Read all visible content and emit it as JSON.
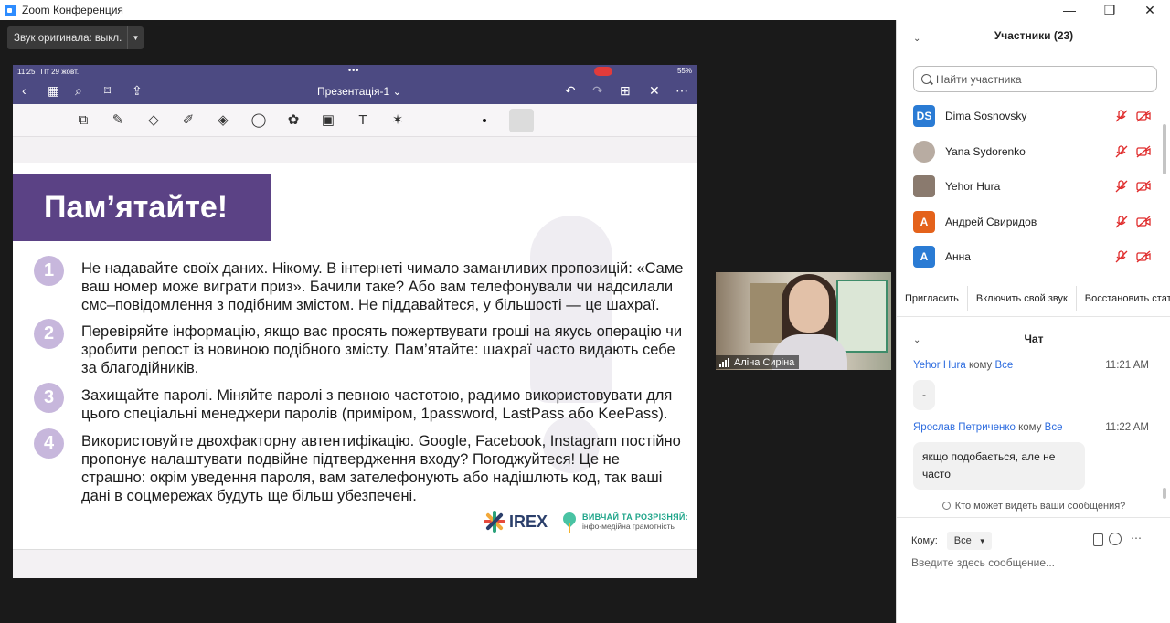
{
  "window": {
    "title": "Zoom Конференция"
  },
  "toolbar": {
    "original_sound_label": "Звук оригинала: выкл."
  },
  "shared_screen": {
    "status_time": "11:25",
    "status_date": "Пт 29 жовт.",
    "battery": "55%",
    "doc_title": "Презентація-1 ⌄",
    "slide": {
      "heading": "Пам’ятайте!",
      "items": [
        {
          "num": "1",
          "text": "Не надавайте своїх даних. Нікому. В інтернеті чимало заманливих пропозицій: «Саме ваш номер може виграти приз». Бачили таке? Або вам телефонували чи надсилали смс–повідомлення з подібним змістом. Не піддавайтеся, у більшості — це шахраї."
        },
        {
          "num": "2",
          "text": "Перевіряйте інформацію, якщо вас просять пожертвувати гроші на якусь операцію чи зробити репост із новиною подібного змісту. Пам’ятайте: шахраї часто видають себе за благодійників."
        },
        {
          "num": "3",
          "text": "Захищайте паролі. Міняйте паролі з певною частотою, радимо використовувати для цього спеціальні менеджери паролів (приміром, 1password, LastPass або KeePass)."
        },
        {
          "num": "4",
          "text": "Використовуйте двохфакторну автентифікацію. Google, Facebook, Instagram постійно пропонує налаштувати подвійне підтвердження входу? Погоджуйтеся! Це не страшно: окрім уведення пароля, вам зателефонують або надішлють код, так ваші дані в соцмережах будуть ще більш убезпечені."
        }
      ],
      "logo_irex": "IREX",
      "logo_vyv_line1": "ВИВЧАЙ ТА РОЗРІЗНЯЙ:",
      "logo_vyv_line2": "інфо-медійна грамотність"
    }
  },
  "video": {
    "participant_name": "Аліна Сиріна"
  },
  "participants": {
    "title": "Участники (23)",
    "search_placeholder": "Найти участника",
    "list": [
      {
        "initials": "DS",
        "name": "Dima Sosnovsky",
        "color": "#2a7bd4"
      },
      {
        "initials": "",
        "name": "Yana Sydorenko",
        "color": ""
      },
      {
        "initials": "",
        "name": "Yehor Hura",
        "color": ""
      },
      {
        "initials": "А",
        "name": "Андрей Свиридов",
        "color": "#e4621b"
      },
      {
        "initials": "А",
        "name": "Анна",
        "color": "#2a7bd4"
      }
    ],
    "buttons": [
      "Пригласить",
      "Включить свой звук",
      "Восстановить статус"
    ]
  },
  "chat": {
    "title": "Чат",
    "messages": [
      {
        "from": "Yehor Hura",
        "to_word": "кому",
        "to": "Все",
        "time": "11:21 AM",
        "text": "-"
      },
      {
        "from": "Ярослав Петриченко",
        "to_word": "кому",
        "to": "Все",
        "time": "11:22 AM",
        "text": "якщо подобається, але не часто"
      }
    ],
    "who_can_see": "Кто может видеть ваши сообщения?",
    "to_label": "Кому:",
    "to_value": "Все",
    "input_placeholder": "Введите здесь сообщение..."
  },
  "colors": {
    "slide_purple": "#5b4285",
    "goodnotes_bar": "#4c4a82",
    "muted_red": "#e02d2d",
    "zoom_blue": "#2d8cff"
  }
}
